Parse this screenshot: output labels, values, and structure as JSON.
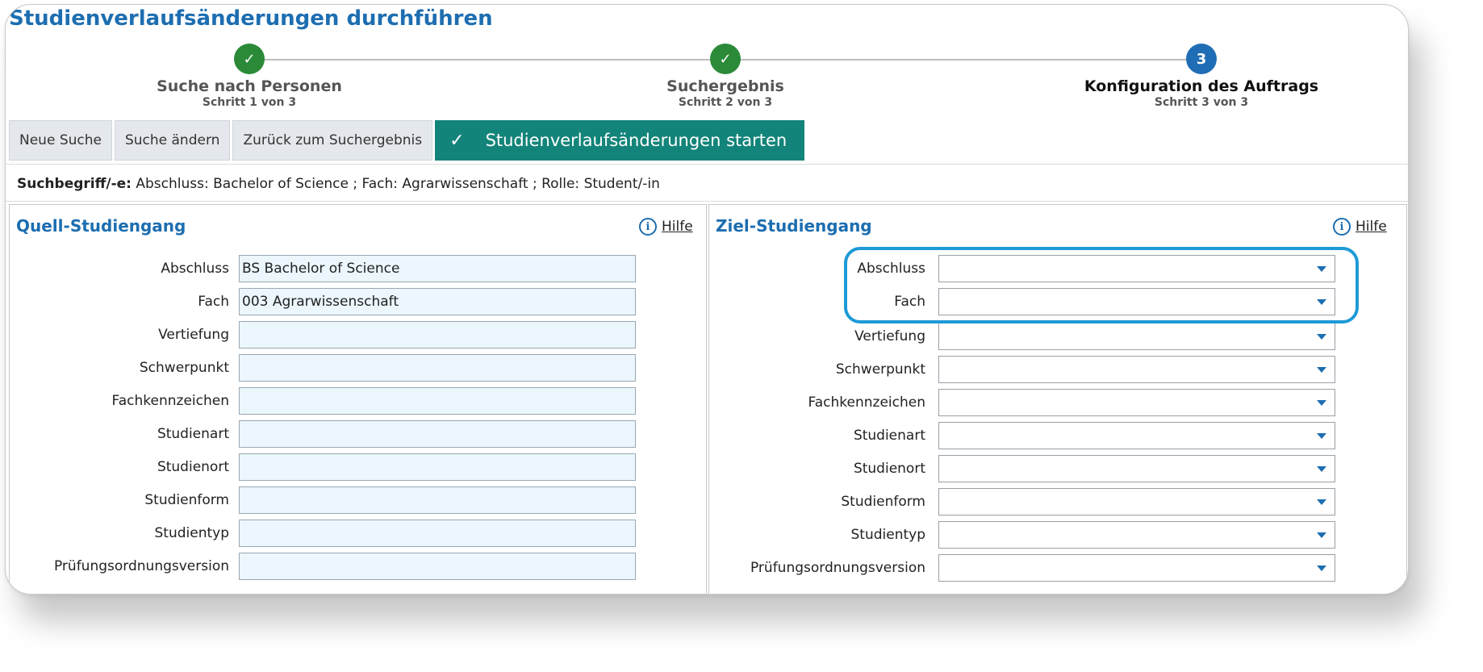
{
  "page_title": "Studienverlaufsänderungen durchführen",
  "stepper": [
    {
      "label": "Suche nach Personen",
      "sub": "Schritt 1 von 3",
      "status": "done",
      "icon": "check-icon"
    },
    {
      "label": "Suchergebnis",
      "sub": "Schritt 2 von 3",
      "status": "done",
      "icon": "check-icon"
    },
    {
      "label": "Konfiguration des Auftrags",
      "sub": "Schritt 3 von 3",
      "status": "current",
      "number": "3"
    }
  ],
  "toolbar": {
    "new_search": "Neue Suche",
    "change_search": "Suche ändern",
    "back_to_results": "Zurück zum Suchergebnis",
    "start": "Studienverlaufsänderungen starten"
  },
  "search_terms": {
    "label": "Suchbegriff/-e:",
    "text": "Abschluss: Bachelor of Science ;  Fach: Agrarwissenschaft ;  Rolle: Student/-in"
  },
  "source": {
    "title": "Quell-Studiengang",
    "help": "Hilfe",
    "fields": [
      {
        "label": "Abschluss",
        "value": "BS Bachelor of Science"
      },
      {
        "label": "Fach",
        "value": "003 Agrarwissenschaft"
      },
      {
        "label": "Vertiefung",
        "value": ""
      },
      {
        "label": "Schwerpunkt",
        "value": ""
      },
      {
        "label": "Fachkennzeichen",
        "value": ""
      },
      {
        "label": "Studienart",
        "value": ""
      },
      {
        "label": "Studienort",
        "value": ""
      },
      {
        "label": "Studienform",
        "value": ""
      },
      {
        "label": "Studientyp",
        "value": ""
      },
      {
        "label": "Prüfungsordnungsversion",
        "value": ""
      }
    ]
  },
  "target": {
    "title": "Ziel-Studiengang",
    "help": "Hilfe",
    "fields": [
      {
        "label": "Abschluss",
        "value": ""
      },
      {
        "label": "Fach",
        "value": ""
      },
      {
        "label": "Vertiefung",
        "value": ""
      },
      {
        "label": "Schwerpunkt",
        "value": ""
      },
      {
        "label": "Fachkennzeichen",
        "value": ""
      },
      {
        "label": "Studienart",
        "value": ""
      },
      {
        "label": "Studienort",
        "value": ""
      },
      {
        "label": "Studienform",
        "value": ""
      },
      {
        "label": "Studientyp",
        "value": ""
      },
      {
        "label": "Prüfungsordnungsversion",
        "value": ""
      }
    ]
  },
  "colors": {
    "accent": "#1d6eb1",
    "done": "#2a8a38",
    "primary_button": "#138479",
    "highlight": "#1e9ad6"
  }
}
